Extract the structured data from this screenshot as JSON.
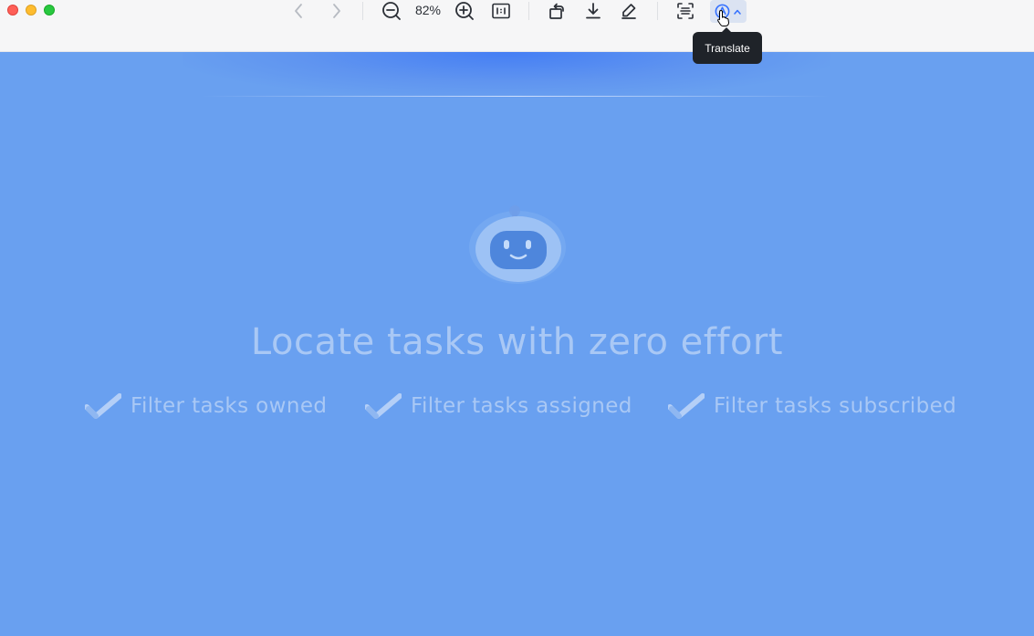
{
  "toolbar": {
    "zoom_level": "82%",
    "tooltip": "Translate",
    "icons": [
      "back-arrow-icon",
      "forward-arrow-icon",
      "zoom-out-icon",
      "zoom-in-icon",
      "actual-size-icon",
      "rotate-icon",
      "download-icon",
      "edit-pen-icon",
      "scan-text-icon",
      "translate-icon",
      "chevron-up-icon"
    ]
  },
  "content": {
    "headline": "Locate tasks with zero effort",
    "features": [
      {
        "label": "Filter tasks owned"
      },
      {
        "label": "Filter tasks assigned"
      },
      {
        "label": "Filter tasks subscribed"
      }
    ]
  },
  "colors": {
    "background": "#69a0f0",
    "text_faded": "#a9c8f5",
    "accent": "#3370ff",
    "tooltip_bg": "#1f2329"
  }
}
